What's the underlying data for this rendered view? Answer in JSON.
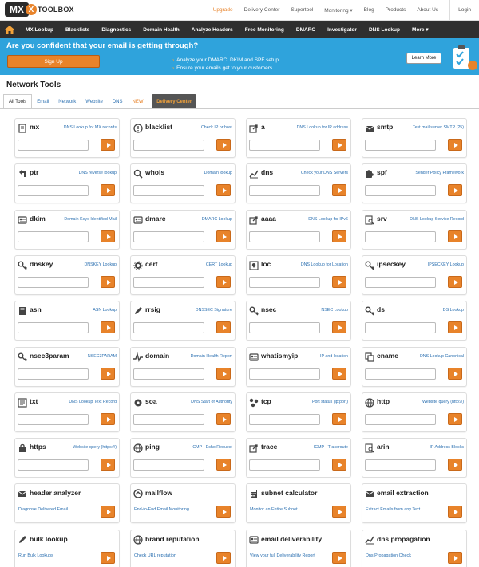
{
  "logo": {
    "mx": "MX",
    "x": "X",
    "toolbox": "TOOLBOX"
  },
  "top_links": [
    "Upgrade",
    "Delivery Center",
    "Supertool",
    "Monitoring ▾",
    "Blog",
    "Products",
    "About Us",
    "Login"
  ],
  "nav": [
    "MX Lookup",
    "Blacklists",
    "Diagnostics",
    "Domain Health",
    "Analyze Headers",
    "Free Monitoring",
    "DMARC",
    "Investigator",
    "DNS Lookup",
    "More ▾"
  ],
  "banner": {
    "title": "Are you confident that your email is getting through?",
    "signup": "Sign Up",
    "points": [
      "Analyze your DMARC, DKIM and SPF setup",
      "Ensure your emails get to your customers"
    ],
    "learn_more": "Learn More",
    "accent": "#2fa3dc"
  },
  "page_title": "Network Tools",
  "tabs": [
    "All Tools",
    "Email",
    "Network",
    "Website",
    "DNS",
    "NEW!",
    "Delivery Center"
  ],
  "colors": {
    "orange": "#e8832a",
    "nav": "#2f2f2f",
    "link": "#2a6fb0"
  },
  "tools": [
    {
      "name": "mx",
      "desc": "DNS Lookup for MX records",
      "icon": "document-icon"
    },
    {
      "name": "blacklist",
      "desc": "Check IP or host",
      "icon": "alert-circle-icon"
    },
    {
      "name": "a",
      "desc": "DNS Lookup for IP address",
      "icon": "share-arrow-icon"
    },
    {
      "name": "smtp",
      "desc": "Test mail server SMTP (25)",
      "icon": "envelope-icon"
    },
    {
      "name": "ptr",
      "desc": "DNS reverse lookup",
      "icon": "reverse-arrow-icon"
    },
    {
      "name": "whois",
      "desc": "Domain lookup",
      "icon": "magnifier-icon"
    },
    {
      "name": "dns",
      "desc": "Check your DNS Servers",
      "icon": "chart-icon"
    },
    {
      "name": "spf",
      "desc": "Sender Policy Framework",
      "icon": "puzzle-icon"
    },
    {
      "name": "dkim",
      "desc": "Domain Keys Identified Mail",
      "icon": "id-card-icon"
    },
    {
      "name": "dmarc",
      "desc": "DMARC Lookup",
      "icon": "id-card-icon"
    },
    {
      "name": "aaaa",
      "desc": "DNS Lookup for IPv6",
      "icon": "share-arrow-icon"
    },
    {
      "name": "srv",
      "desc": "DNS Lookup Service Record",
      "icon": "search-doc-icon"
    },
    {
      "name": "dnskey",
      "desc": "DNSKEY Lookup",
      "icon": "key-icon"
    },
    {
      "name": "cert",
      "desc": "CERT Lookup",
      "icon": "gear-icon"
    },
    {
      "name": "loc",
      "desc": "DNS Lookup for Location",
      "icon": "location-icon"
    },
    {
      "name": "ipseckey",
      "desc": "IPSECKEY Lookup",
      "icon": "key-icon"
    },
    {
      "name": "asn",
      "desc": "ASN Lookup",
      "icon": "book-icon"
    },
    {
      "name": "rrsig",
      "desc": "DNSSEC Signature",
      "icon": "pen-icon"
    },
    {
      "name": "nsec",
      "desc": "NSEC Lookup",
      "icon": "key-icon"
    },
    {
      "name": "ds",
      "desc": "DS Lookup",
      "icon": "key-icon"
    },
    {
      "name": "nsec3param",
      "desc": "NSEC3PARAM",
      "icon": "key-icon"
    },
    {
      "name": "domain",
      "desc": "Domain Health Report",
      "icon": "pulse-icon"
    },
    {
      "name": "whatismyip",
      "desc": "IP and location",
      "icon": "id-card-icon"
    },
    {
      "name": "cname",
      "desc": "DNS Lookup Canonical",
      "icon": "copy-icon"
    },
    {
      "name": "txt",
      "desc": "DNS Lookup Text Record",
      "icon": "text-doc-icon"
    },
    {
      "name": "soa",
      "desc": "DNS Start of Authority",
      "icon": "badge-icon"
    },
    {
      "name": "tcp",
      "desc": "Port status (ip:port)",
      "icon": "network-icon"
    },
    {
      "name": "http",
      "desc": "Website query (http://)",
      "icon": "globe-icon"
    },
    {
      "name": "https",
      "desc": "Website query (https://)",
      "icon": "lock-icon"
    },
    {
      "name": "ping",
      "desc": "ICMP - Echo Request",
      "icon": "globe-icon"
    },
    {
      "name": "trace",
      "desc": "ICMP - Traceroute",
      "icon": "share-arrow-icon"
    },
    {
      "name": "arin",
      "desc": "IP Address Blocks",
      "icon": "search-doc-icon"
    }
  ],
  "big_tools": [
    {
      "name": "header analyzer",
      "desc": "Diagnose Delivered Email",
      "icon": "envelope-icon"
    },
    {
      "name": "mailflow",
      "desc": "End-to-End Email Monitoring",
      "icon": "mail-flow-icon"
    },
    {
      "name": "subnet calculator",
      "desc": "Monitor an Entire Subnet",
      "icon": "calculator-icon"
    },
    {
      "name": "email extraction",
      "desc": "Extract Emails from any Text",
      "icon": "envelope-icon"
    },
    {
      "name": "bulk lookup",
      "desc": "Run Bulk Lookups",
      "icon": "pen-icon"
    },
    {
      "name": "brand reputation",
      "desc": "Check URL reputation",
      "icon": "globe-icon"
    },
    {
      "name": "email deliverability",
      "desc": "View your full Deliverability Report",
      "icon": "id-card-icon"
    },
    {
      "name": "dns propagation",
      "desc": "Dns Propagation Check",
      "icon": "chart-icon"
    }
  ]
}
